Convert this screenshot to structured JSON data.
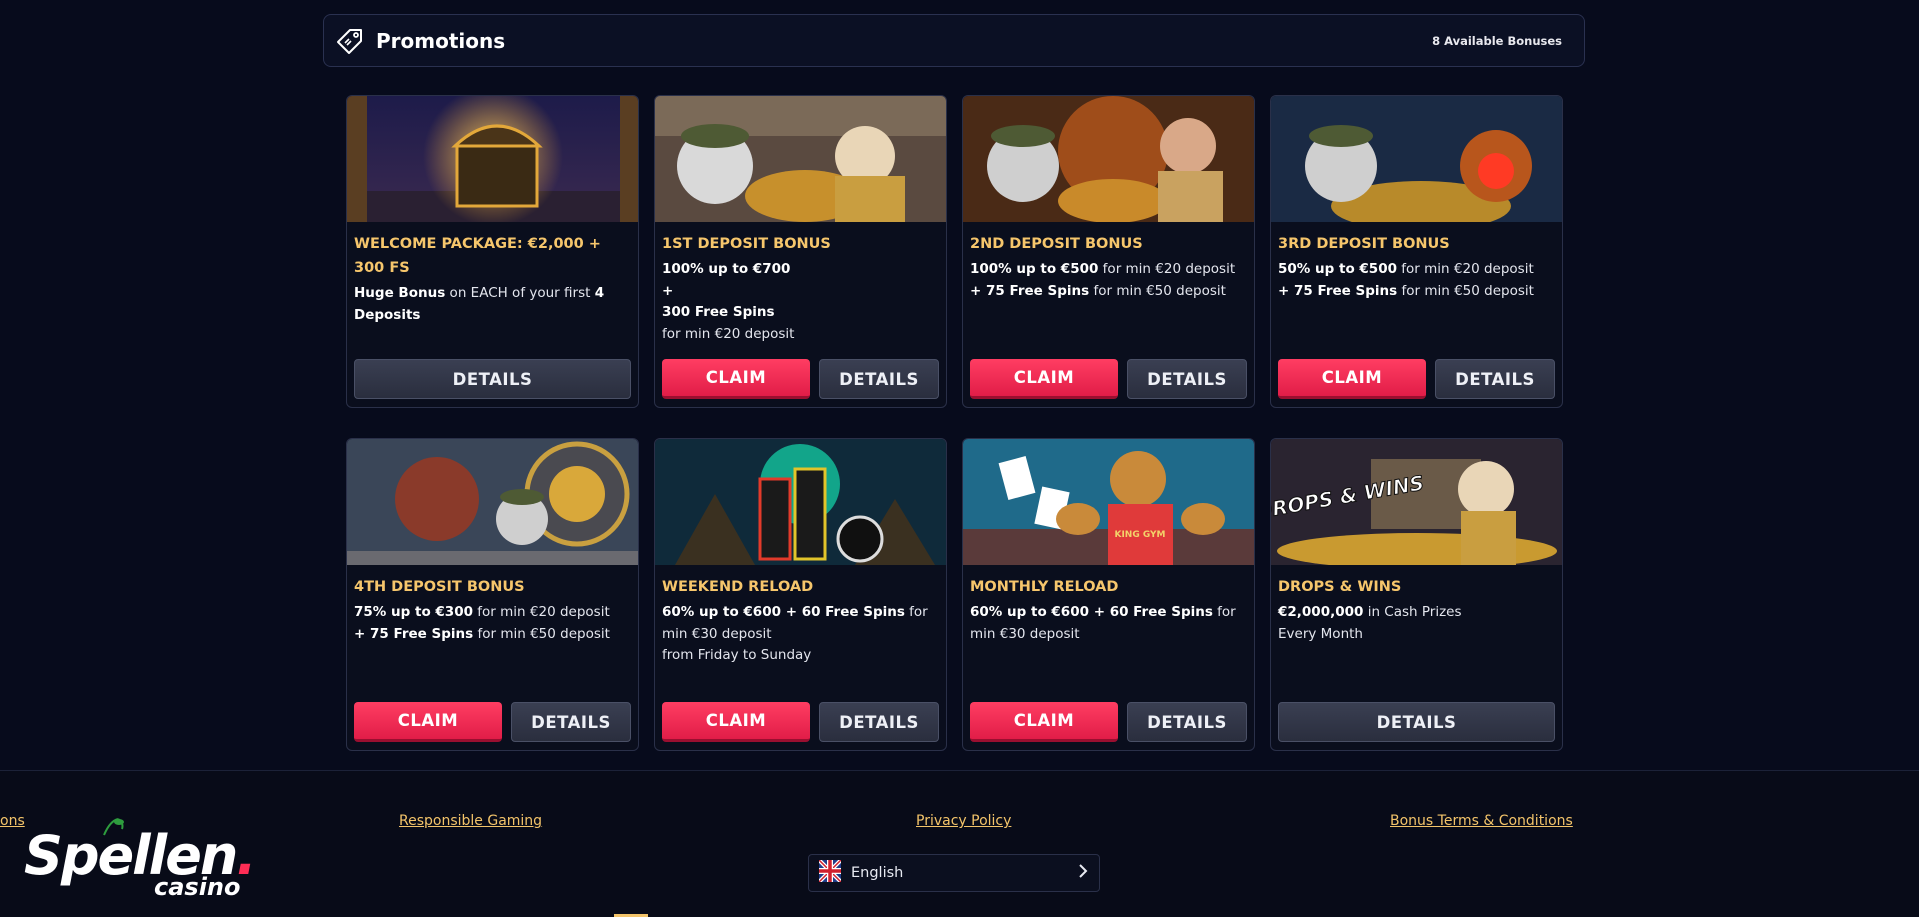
{
  "header": {
    "title": "Promotions",
    "count_label": "8 Available Bonuses"
  },
  "promos": [
    {
      "title": "WELCOME PACKAGE: €2,000 + 300 FS",
      "lines": [
        [
          "Huge Bonus",
          " on EACH of your first ",
          "4 Deposits"
        ]
      ],
      "claim": "",
      "details": "DETAILS"
    },
    {
      "title": "1ST DEPOSIT BONUS",
      "lines": [
        [
          "100% up to €700"
        ],
        [
          "+"
        ],
        [
          "300 Free Spins"
        ],
        [
          "",
          "for min €20 deposit"
        ]
      ],
      "claim": "CLAIM",
      "details": "DETAILS"
    },
    {
      "title": "2ND DEPOSIT BONUS",
      "lines": [
        [
          "100% up to €500",
          " for min €20 deposit"
        ],
        [
          "+ 75 Free Spins",
          " for min €50 deposit"
        ]
      ],
      "claim": "CLAIM",
      "details": "DETAILS"
    },
    {
      "title": "3RD DEPOSIT BONUS",
      "lines": [
        [
          "50% up to €500",
          " for min €20 deposit"
        ],
        [
          "+ 75 Free Spins",
          " for min €50 deposit"
        ]
      ],
      "claim": "CLAIM",
      "details": "DETAILS"
    },
    {
      "title": "4TH DEPOSIT BONUS",
      "lines": [
        [
          "75% up to €300",
          " for min €20 deposit"
        ],
        [
          "+ 75 Free Spins",
          " for min €50 deposit"
        ]
      ],
      "claim": "CLAIM",
      "details": "DETAILS"
    },
    {
      "title": "WEEKEND RELOAD",
      "lines": [
        [
          "60% up to €600 + 60 Free Spins",
          " for min €30 deposit"
        ],
        [
          "",
          "from Friday to Sunday"
        ]
      ],
      "claim": "CLAIM",
      "details": "DETAILS"
    },
    {
      "title": "MONTHLY RELOAD",
      "lines": [
        [
          "60% up to €600 + 60 Free Spins",
          " for min €30 deposit"
        ]
      ],
      "claim": "CLAIM",
      "details": "DETAILS"
    },
    {
      "title": "DROPS & WINS",
      "lines": [
        [
          "€2,000,000",
          " in Cash Prizes"
        ],
        [
          "",
          "Every Month"
        ]
      ],
      "claim": "",
      "details": "DETAILS"
    }
  ],
  "footer": {
    "link_partial": "ons",
    "link_responsible": "Responsible Gaming",
    "link_privacy": "Privacy Policy",
    "link_terms": "Bonus Terms & Conditions",
    "language": "English",
    "logo_main": "Spellen",
    "logo_sub": "casino"
  },
  "image_text": {
    "drops_wins": "DROPS & WINS",
    "king_gym": "KING GYM"
  },
  "colors": {
    "accent_gold": "#f6c66c",
    "claim_red": "#e11d48",
    "background": "#070b1c"
  }
}
